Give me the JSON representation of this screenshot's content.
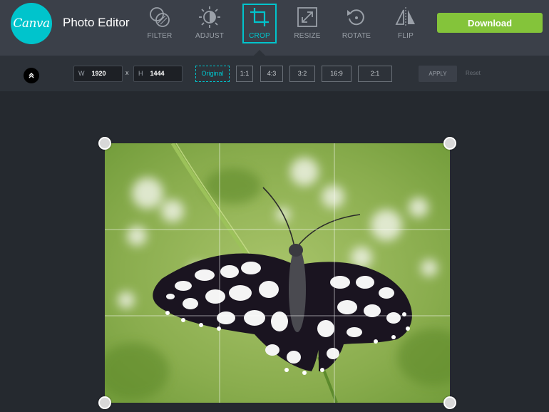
{
  "header": {
    "logo_text": "Canva",
    "app_title": "Photo Editor",
    "tools": [
      {
        "id": "filter",
        "label": "FILTER",
        "icon": "filter-icon",
        "active": false
      },
      {
        "id": "adjust",
        "label": "ADJUST",
        "icon": "adjust-icon",
        "active": false
      },
      {
        "id": "crop",
        "label": "CROP",
        "icon": "crop-icon",
        "active": true
      },
      {
        "id": "resize",
        "label": "RESIZE",
        "icon": "resize-icon",
        "active": false
      },
      {
        "id": "rotate",
        "label": "ROTATE",
        "icon": "rotate-icon",
        "active": false
      },
      {
        "id": "flip",
        "label": "FLIP",
        "icon": "flip-icon",
        "active": false
      }
    ],
    "download_label": "Download"
  },
  "crop_toolbar": {
    "collapse_icon": "chevron-up-icon",
    "width_label": "W",
    "width_value": "1920",
    "times": "x",
    "height_label": "H",
    "height_value": "1444",
    "ratios": [
      {
        "label": "Original",
        "active": true
      },
      {
        "label": "1:1",
        "active": false
      },
      {
        "label": "4:3",
        "active": false
      },
      {
        "label": "3:2",
        "active": false
      },
      {
        "label": "16:9",
        "active": false
      },
      {
        "label": "2:1",
        "active": false
      }
    ],
    "apply_label": "APPLY",
    "reset_label": "Reset"
  },
  "canvas": {
    "image_subject": "butterfly-photo",
    "grid": "rule-of-thirds"
  },
  "colors": {
    "accent": "#00c4cc",
    "download": "#84c43a",
    "topbar": "#3b4049",
    "toolbar": "#2d3239",
    "background": "#25292f"
  }
}
